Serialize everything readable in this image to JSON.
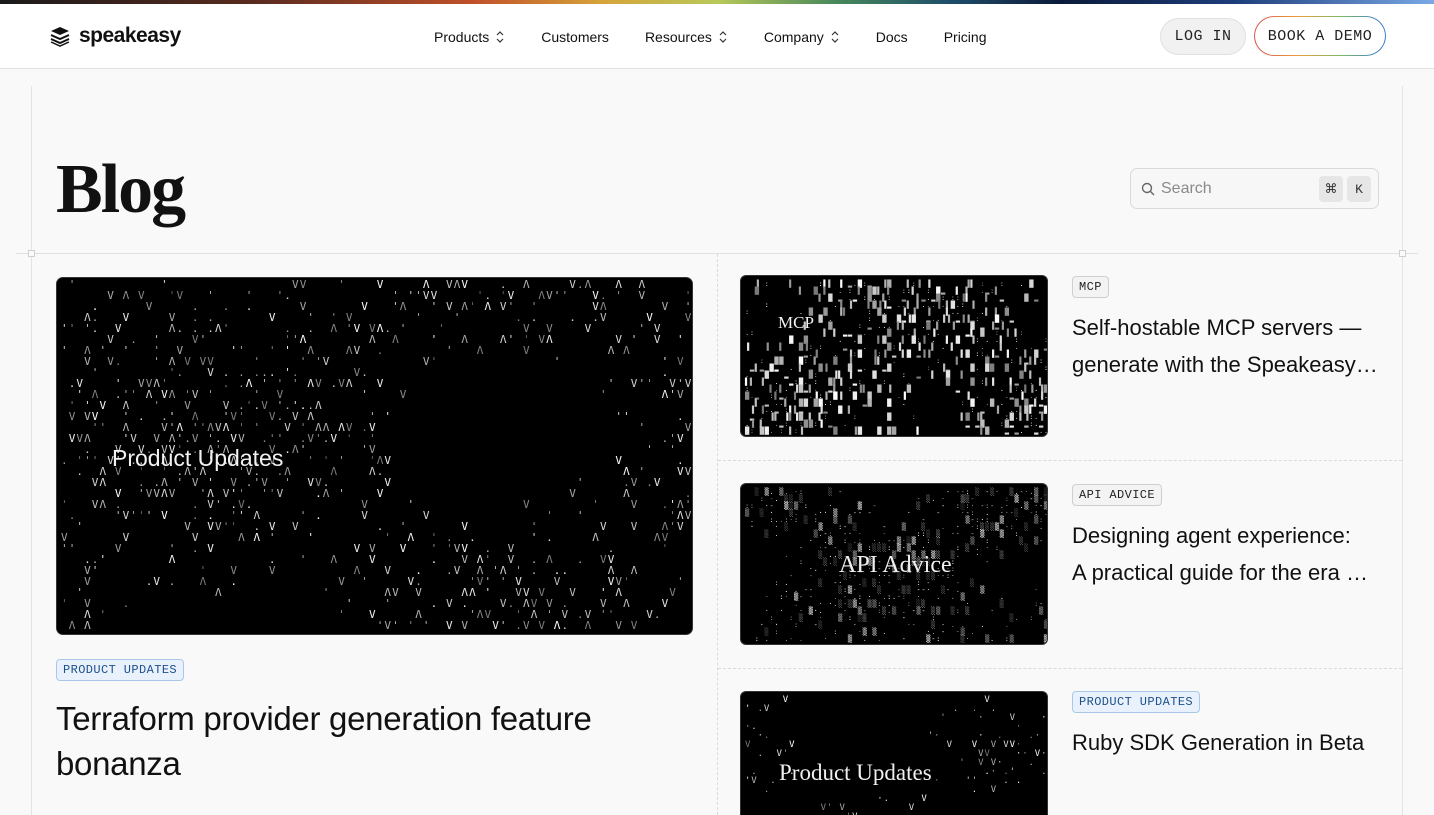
{
  "brand": {
    "name": "speakeasy",
    "logo_icon": "stacked-layers-icon"
  },
  "nav": {
    "products": "Products",
    "customers": "Customers",
    "resources": "Resources",
    "company": "Company",
    "docs": "Docs",
    "pricing": "Pricing"
  },
  "actions": {
    "login": "LOG IN",
    "demo": "BOOK A DEMO"
  },
  "page": {
    "title": "Blog"
  },
  "search": {
    "placeholder": "Search",
    "key_mod": "⌘",
    "key_letter": "K"
  },
  "featured": {
    "image_label": "Product Updates",
    "tag": "PRODUCT UPDATES",
    "title": "Terraform provider generation feature bonanza"
  },
  "posts": [
    {
      "image_label": "MCP",
      "tag": "MCP",
      "title_line1": "Self-hostable MCP servers —",
      "title_line2": "generate with the Speakeasy CLI"
    },
    {
      "image_label": "API Advice",
      "tag": "API ADVICE",
      "title_line1": "Designing agent experience:",
      "title_line2": "A practical guide for the era of AI agents"
    },
    {
      "image_label": "Product Updates",
      "tag": "PRODUCT UPDATES",
      "title_line1": "Ruby SDK Generation in Beta",
      "title_line2": ""
    }
  ],
  "colors": {
    "accent_blue": "#1c4f8a",
    "tag_blue_bg": "#e9f2fc",
    "card_bg": "#000000"
  }
}
